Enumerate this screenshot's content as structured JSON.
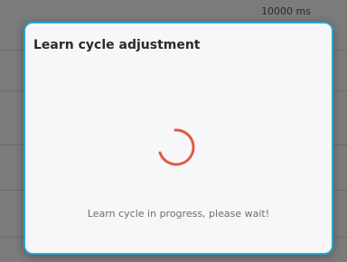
{
  "background": {
    "value_label": "10000 ms"
  },
  "dialog": {
    "title": "Learn cycle adjustment",
    "status": "Learn cycle in progress, please wait!",
    "spinner_icon": "loading-spinner-icon",
    "accent_color": "#2aa3cc",
    "spinner_color": "#e05a44"
  }
}
